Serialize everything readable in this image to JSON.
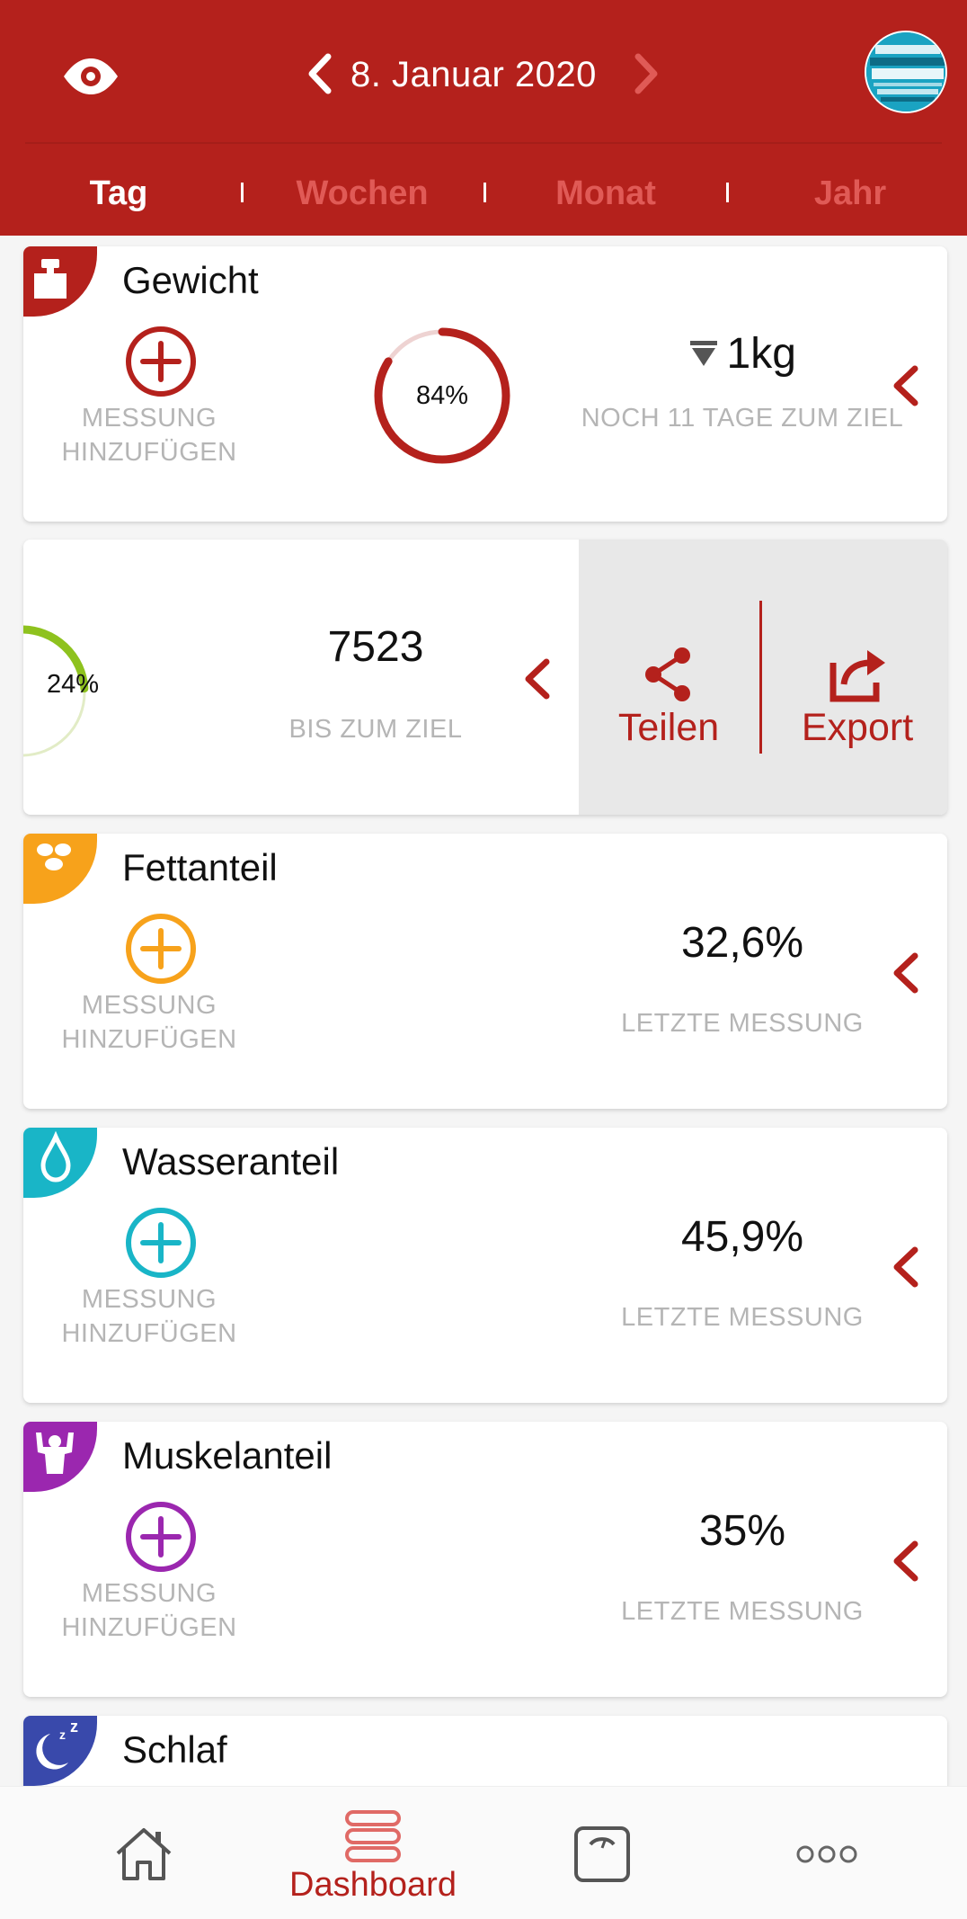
{
  "header": {
    "date": "8. Januar 2020",
    "tabs": [
      {
        "label": "Tag",
        "active": true
      },
      {
        "label": "Wochen",
        "active": false
      },
      {
        "label": "Monat",
        "active": false
      },
      {
        "label": "Jahr",
        "active": false
      }
    ],
    "icons": {
      "visibility": "eye-icon",
      "prev": "chevron-left-icon",
      "next": "chevron-right-icon",
      "avatar": "user-avatar"
    }
  },
  "colors": {
    "brand": "#b4211c",
    "fat": "#f7a21b",
    "water": "#19b5c7",
    "muscle": "#9b27af",
    "sleep": "#3949ab",
    "steps": "#8ec21e",
    "muted_text": "#b5b5b5"
  },
  "cards": {
    "weight": {
      "title": "Gewicht",
      "add_label": "MESSUNG HINZUFÜGEN",
      "progress": "84%",
      "progress_value": 0.84,
      "value": "1kg",
      "sub": "NOCH 11 TAGE ZUM ZIEL",
      "icon": "weight-icon"
    },
    "steps": {
      "progress": "24%",
      "progress_value": 0.24,
      "value": "7523",
      "sub": "BIS ZUM ZIEL",
      "actions": {
        "share": "Teilen",
        "export": "Export"
      }
    },
    "fat": {
      "title": "Fettanteil",
      "add_label": "MESSUNG HINZUFÜGEN",
      "value": "32,6%",
      "sub": "LETZTE MESSUNG",
      "icon": "fat-icon"
    },
    "water": {
      "title": "Wasseranteil",
      "add_label": "MESSUNG HINZUFÜGEN",
      "value": "45,9%",
      "sub": "LETZTE MESSUNG",
      "icon": "water-drop-icon"
    },
    "muscle": {
      "title": "Muskelanteil",
      "add_label": "MESSUNG HINZUFÜGEN",
      "value": "35%",
      "sub": "LETZTE MESSUNG",
      "icon": "muscle-icon"
    },
    "sleep": {
      "title": "Schlaf",
      "icon": "sleep-moon-icon"
    }
  },
  "bottom_nav": {
    "items": [
      {
        "name": "home",
        "label": "",
        "icon": "home-icon"
      },
      {
        "name": "dashboard",
        "label": "Dashboard",
        "icon": "dashboard-icon",
        "active": true
      },
      {
        "name": "scale",
        "label": "",
        "icon": "scale-icon"
      },
      {
        "name": "more",
        "label": "",
        "icon": "more-icon"
      }
    ]
  }
}
